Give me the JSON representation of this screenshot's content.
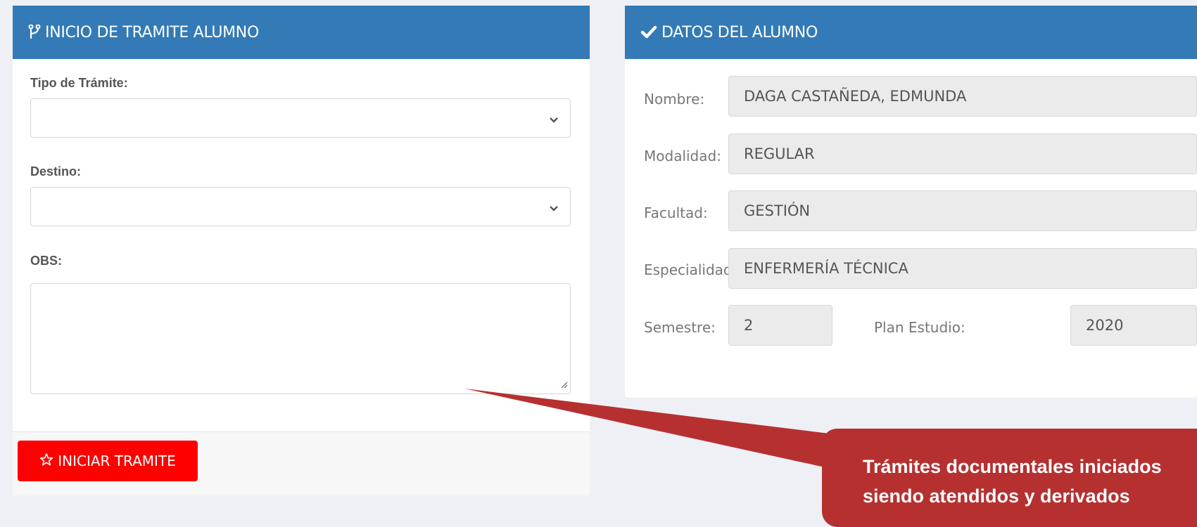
{
  "left_panel": {
    "title": "INICIO DE TRAMITE ALUMNO",
    "tipo_label": "Tipo de Trámite:",
    "tipo_value": "",
    "destino_label": "Destino:",
    "destino_value": "",
    "obs_label": "OBS:",
    "obs_value": "",
    "submit_label": "INICIAR TRAMITE"
  },
  "right_panel": {
    "title": "DATOS DEL ALUMNO",
    "fields": [
      {
        "label": "Nombre:",
        "value": "DAGA CASTAÑEDA, EDMUNDA"
      },
      {
        "label": "Modalidad:",
        "value": "REGULAR"
      },
      {
        "label": "Facultad:",
        "value": "GESTIÓN"
      },
      {
        "label": "Especialidad:",
        "value": "ENFERMERÍA TÉCNICA"
      }
    ],
    "semestre_label": "Semestre:",
    "semestre_value": "2",
    "plan_label": "Plan Estudio:",
    "plan_value": "2020"
  },
  "callout": {
    "line1": "Trámites documentales iniciados",
    "line2": "siendo atendidos y derivados"
  },
  "colors": {
    "header_blue": "#337ab7",
    "button_red": "#ff0000",
    "callout_red": "#b63030",
    "page_bg": "#eef0f5"
  },
  "icons": {
    "left_header": "fork-icon",
    "right_header": "check-icon",
    "submit_button": "star-icon",
    "selects": "chevron-down-icon"
  }
}
